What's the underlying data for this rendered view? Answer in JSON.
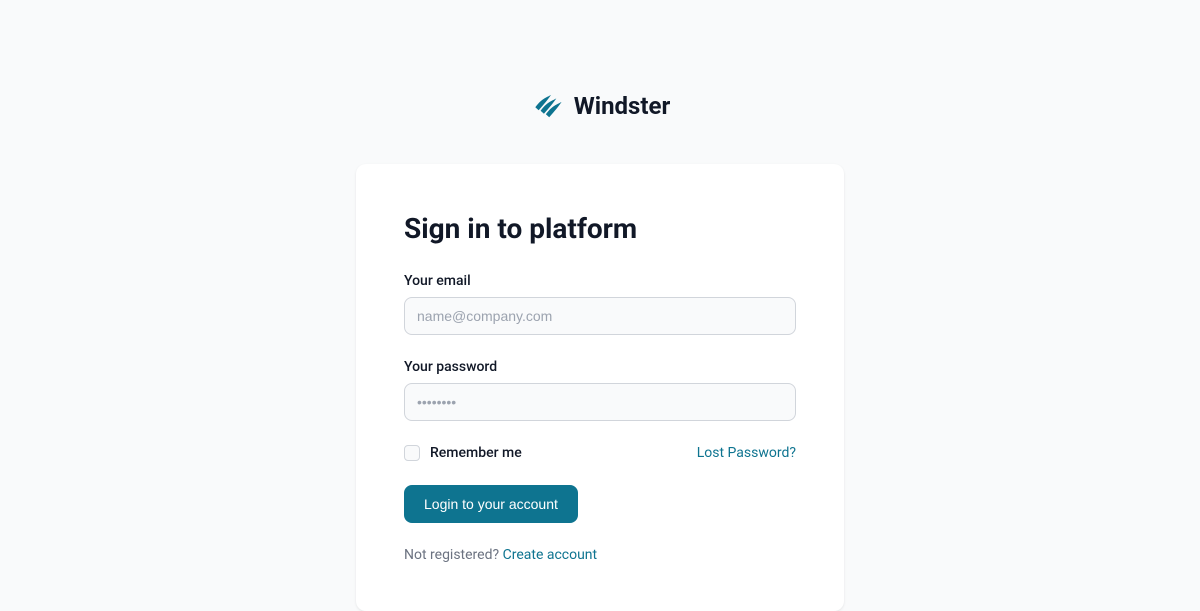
{
  "brand": {
    "name": "Windster"
  },
  "card": {
    "title": "Sign in to platform",
    "email": {
      "label": "Your email",
      "placeholder": "name@company.com",
      "value": ""
    },
    "password": {
      "label": "Your password",
      "placeholder": "••••••••",
      "value": ""
    },
    "remember": {
      "label": "Remember me",
      "checked": false
    },
    "lost_password": "Lost Password?",
    "submit": "Login to your account",
    "footer": {
      "prefix": "Not registered? ",
      "link": "Create account"
    }
  }
}
